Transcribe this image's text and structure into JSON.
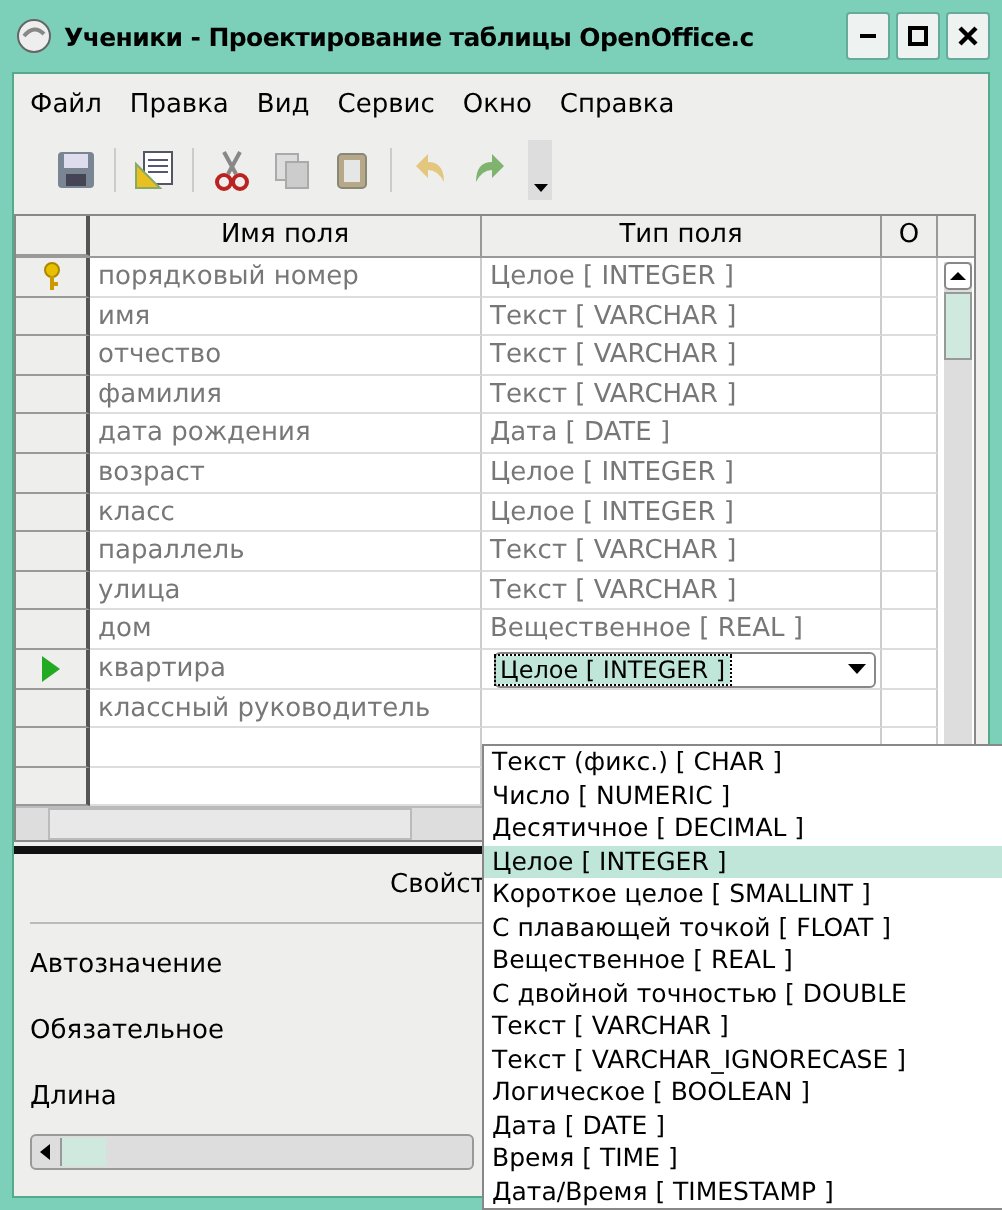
{
  "window": {
    "title": "Ученики - Проектирование таблицы OpenOffice.c"
  },
  "menu": [
    "Файл",
    "Правка",
    "Вид",
    "Сервис",
    "Окно",
    "Справка"
  ],
  "table": {
    "columns": [
      "Имя поля",
      "Тип поля",
      "О"
    ],
    "rows": [
      {
        "name": "порядковый номер",
        "type": "Целое [ INTEGER ]",
        "primary_key": true,
        "current": false
      },
      {
        "name": "имя",
        "type": "Текст [ VARCHAR ]",
        "primary_key": false,
        "current": false
      },
      {
        "name": "отчество",
        "type": "Текст [ VARCHAR ]",
        "primary_key": false,
        "current": false
      },
      {
        "name": "фамилия",
        "type": "Текст [ VARCHAR ]",
        "primary_key": false,
        "current": false
      },
      {
        "name": "дата рождения",
        "type": "Дата [ DATE ]",
        "primary_key": false,
        "current": false
      },
      {
        "name": "возраст",
        "type": "Целое [ INTEGER ]",
        "primary_key": false,
        "current": false
      },
      {
        "name": "класс",
        "type": "Целое [ INTEGER ]",
        "primary_key": false,
        "current": false
      },
      {
        "name": "параллель",
        "type": "Текст [ VARCHAR ]",
        "primary_key": false,
        "current": false
      },
      {
        "name": "улица",
        "type": "Текст [ VARCHAR ]",
        "primary_key": false,
        "current": false
      },
      {
        "name": "дом",
        "type": "Вещественное [ REAL ]",
        "primary_key": false,
        "current": false
      },
      {
        "name": "квартира",
        "type": "Целое [ INTEGER ]",
        "primary_key": false,
        "current": true
      },
      {
        "name": "классный руководитель",
        "primary_key": false,
        "current": false
      },
      {
        "primary_key": false,
        "current": false
      },
      {
        "primary_key": false,
        "current": false
      }
    ]
  },
  "properties": {
    "heading": "Свойст",
    "labels": [
      "Автозначение",
      "Обязательное",
      "Длина"
    ]
  },
  "type_dropdown": [
    {
      "label": "Текст (фикс.) [ CHAR ]",
      "selected": false
    },
    {
      "label": "Число [ NUMERIC ]",
      "selected": false
    },
    {
      "label": "Десятичное [ DECIMAL ]",
      "selected": false
    },
    {
      "label": "Целое [ INTEGER ]",
      "selected": true
    },
    {
      "label": "Короткое целое [ SMALLINT ]",
      "selected": false
    },
    {
      "label": "С плавающей точкой [ FLOAT ]",
      "selected": false
    },
    {
      "label": "Вещественное [ REAL ]",
      "selected": false
    },
    {
      "label": "С двойной точностью [ DOUBLE",
      "selected": false
    },
    {
      "label": "Текст [ VARCHAR ]",
      "selected": false
    },
    {
      "label": "Текст [ VARCHAR_IGNORECASE ]",
      "selected": false
    },
    {
      "label": "Логическое [ BOOLEAN ]",
      "selected": false
    },
    {
      "label": "Дата [ DATE ]",
      "selected": false
    },
    {
      "label": "Время [ TIME ]",
      "selected": false
    },
    {
      "label": "Дата/Время [ TIMESTAMP ]",
      "selected": false
    }
  ]
}
